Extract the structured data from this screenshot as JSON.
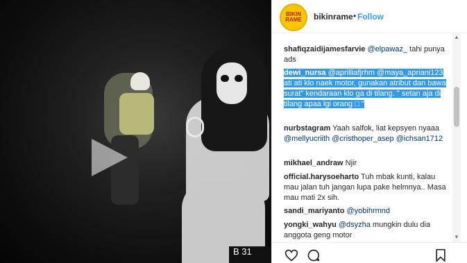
{
  "post": {
    "username": "bikinrame",
    "separator": "•",
    "follow_label": "Follow",
    "avatar_text_top": "BIKIN",
    "avatar_text_bottom": "RAME"
  },
  "video": {
    "plate_text": "B 31"
  },
  "comments": [
    {
      "user": "shafiqzaidijamesfarvie",
      "mention": "@elpawaz_",
      "text": " tahi punya ads"
    },
    {
      "user": "dewi_nursa",
      "mentions": "@aprilliafjrhm @maya_apriani123",
      "text": " ati ati klo naek motor, gunakan atribut dan bawa surat\" kendaraan klo ga di tilang. \" setan aja di tilang apaa lgi orang □ \"",
      "highlighted": true
    },
    {
      "user": "nurbstagram",
      "text": " Yaah salfok, liat kepsyen nyaaa ",
      "mentions": "@mellyucriith @cristhoper_asep @ichsan1712"
    },
    {
      "user": "mikhael_andraw",
      "text": " Njir"
    },
    {
      "user": "official.harysoeharto",
      "text": " Tuh mbak kunti, kalau mau jalan tuh jangan lupa pake helmnya.. Masa mau mati 2x sih."
    },
    {
      "user": "sandi_mariyanto",
      "mention": "@yobihrmnd"
    },
    {
      "user": "yongki_wahyu",
      "mention": "@dsyzha",
      "text": " mungkin dulu dia anggota geng motor"
    }
  ],
  "icons": {
    "play": "play-icon",
    "like": "heart-icon",
    "comment": "comment-icon",
    "save": "bookmark-icon"
  },
  "colors": {
    "link": "#3897f0",
    "highlight": "#3298e8",
    "text": "#262626"
  }
}
